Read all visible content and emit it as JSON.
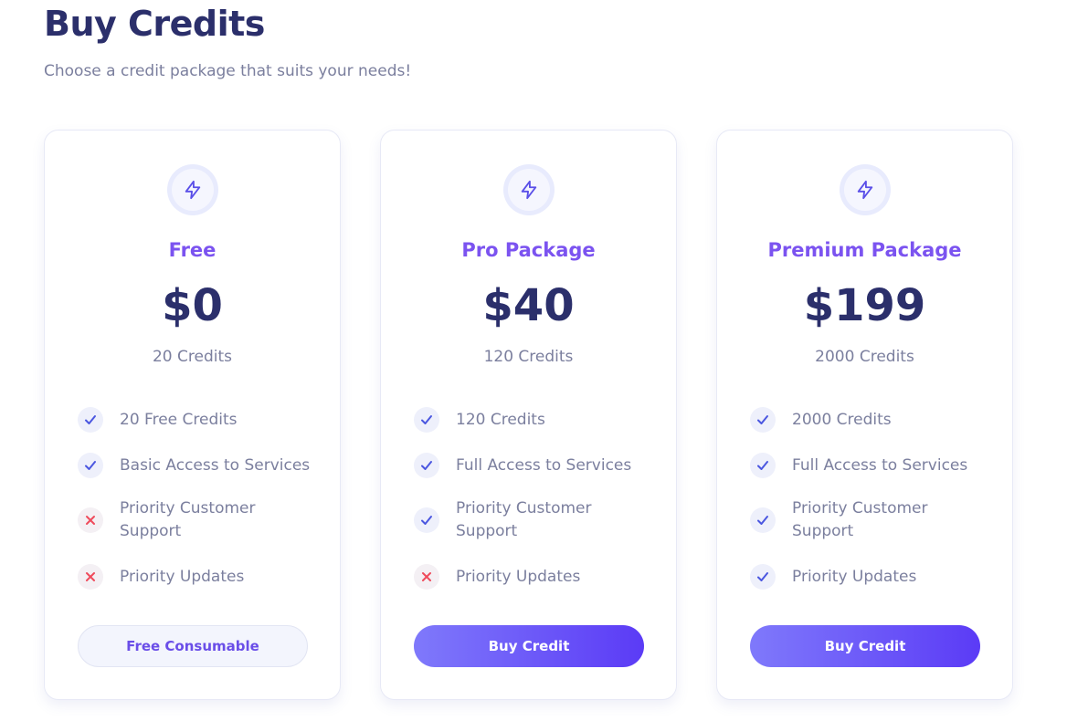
{
  "header": {
    "title": "Buy Credits",
    "subtitle": "Choose a credit package that suits your needs!"
  },
  "colors": {
    "title": "#2b2f6b",
    "accent": "#7b53f0",
    "check": "#4b57e0",
    "cross": "#ef4b5c"
  },
  "plans": [
    {
      "icon": "lightning-icon",
      "name": "Free",
      "price": "$0",
      "credits": "20 Credits",
      "features": [
        {
          "label": "20 Free Credits",
          "included": true
        },
        {
          "label": "Basic Access to Services",
          "included": true
        },
        {
          "label": "Priority Customer Support",
          "included": false
        },
        {
          "label": "Priority Updates",
          "included": false
        }
      ],
      "button": "Free Consumable"
    },
    {
      "icon": "lightning-icon",
      "name": "Pro Package",
      "price": "$40",
      "credits": "120 Credits",
      "features": [
        {
          "label": "120 Credits",
          "included": true
        },
        {
          "label": "Full Access to Services",
          "included": true
        },
        {
          "label": "Priority Customer Support",
          "included": true
        },
        {
          "label": "Priority Updates",
          "included": false
        }
      ],
      "button": "Buy Credit"
    },
    {
      "icon": "lightning-icon",
      "name": "Premium Package",
      "price": "$199",
      "credits": "2000 Credits",
      "features": [
        {
          "label": "2000 Credits",
          "included": true
        },
        {
          "label": "Full Access to Services",
          "included": true
        },
        {
          "label": "Priority Customer Support",
          "included": true
        },
        {
          "label": "Priority Updates",
          "included": true
        }
      ],
      "button": "Buy Credit"
    }
  ]
}
